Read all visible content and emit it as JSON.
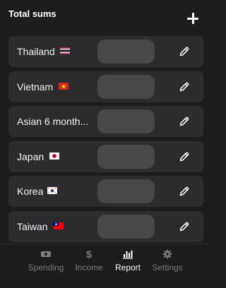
{
  "header": {
    "title": "Total sums"
  },
  "rows": [
    {
      "label": "Thailand",
      "flag": "thailand-flag-icon"
    },
    {
      "label": "Vietnam",
      "flag": "vietnam-flag-icon"
    },
    {
      "label": "Asian 6 month...",
      "flag": ""
    },
    {
      "label": "Japan",
      "flag": "japan-flag-icon"
    },
    {
      "label": "Korea",
      "flag": "korea-flag-icon"
    },
    {
      "label": "Taiwan",
      "flag": "taiwan-flag-icon"
    }
  ],
  "tabs": [
    {
      "label": "Spending",
      "icon": "banknote-icon",
      "active": false
    },
    {
      "label": "Income",
      "icon": "dollar-icon",
      "active": false
    },
    {
      "label": "Report",
      "icon": "bar-chart-icon",
      "active": true
    },
    {
      "label": "Settings",
      "icon": "gear-icon",
      "active": false
    }
  ],
  "colors": {
    "background": "#1c1c1e",
    "row": "#2c2c2e",
    "placeholder": "#48484a",
    "inactive_tab": "#7c7c80"
  }
}
